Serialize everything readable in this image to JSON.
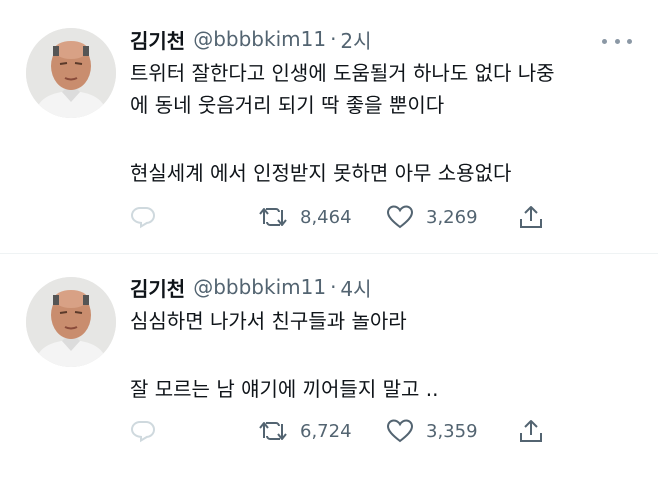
{
  "tweets": [
    {
      "author_name": "김기천",
      "handle": "@bbbbkim11",
      "separator": "·",
      "time": "2시",
      "text_lines": [
        "트위터 잘한다고 인생에 도움될거 하나도 없다 나중",
        "에 동네 웃음거리 되기 딱 좋을 뿐이다",
        "",
        "현실세계 에서 인정받지 못하면 아무 소용없다"
      ],
      "retweets": "8,464",
      "likes": "3,269"
    },
    {
      "author_name": "김기천",
      "handle": "@bbbbkim11",
      "separator": "·",
      "time": "4시",
      "text_lines": [
        "심심하면 나가서 친구들과 놀아라",
        "",
        "잘 모르는 남 얘기에 끼어들지 말고 .."
      ],
      "retweets": "6,724",
      "likes": "3,359"
    }
  ],
  "icons": {
    "reply": "reply-icon",
    "retweet": "retweet-icon",
    "like": "like-icon",
    "share": "share-icon",
    "more": "more-icon"
  },
  "colors": {
    "text": "#0f1419",
    "secondary": "#536471",
    "divider": "#eff3f4",
    "reply_icon_faded": "#cfd9de"
  }
}
